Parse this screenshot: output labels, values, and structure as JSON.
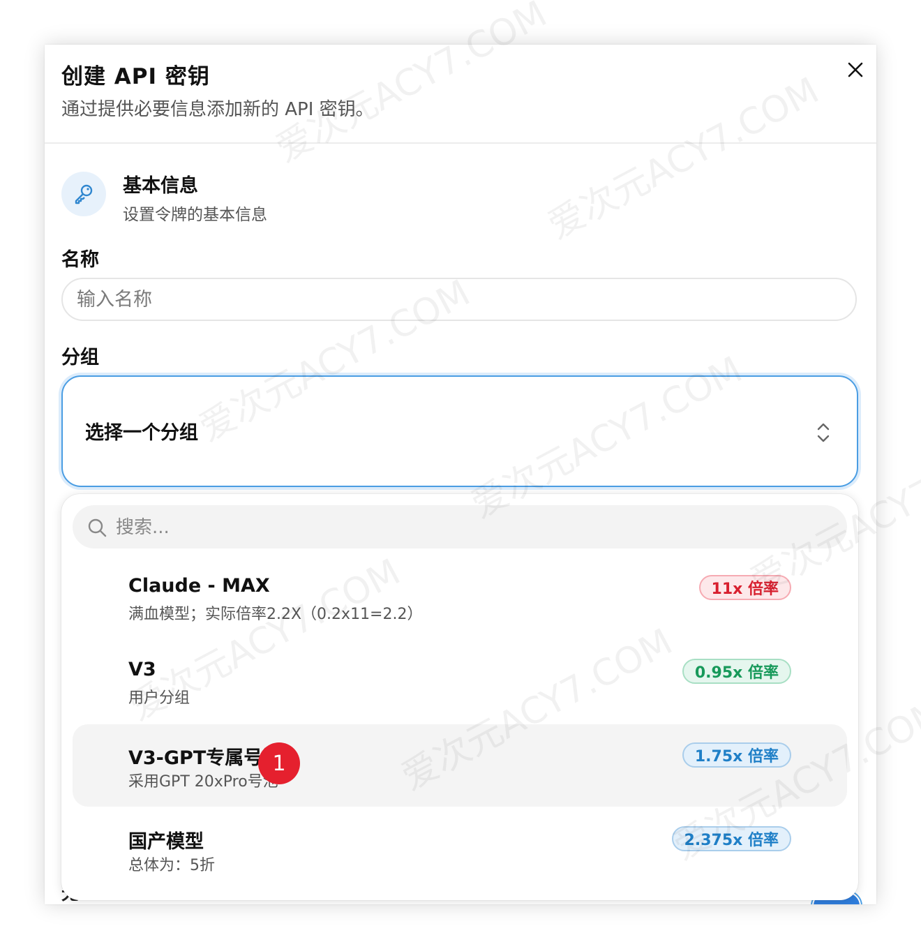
{
  "dialog": {
    "title": "创建 API 密钥",
    "subtitle": "通过提供必要信息添加新的 API 密钥。",
    "close_icon": "close-icon"
  },
  "section": {
    "icon": "key-icon",
    "title": "基本信息",
    "subtitle": "设置令牌的基本信息"
  },
  "name_field": {
    "label": "名称",
    "placeholder": "输入名称",
    "value": ""
  },
  "group_field": {
    "label": "分组",
    "selected": "选择一个分组",
    "chevron_icon": "chevron-up-down-icon"
  },
  "dropdown": {
    "search_placeholder": "搜索...",
    "search_icon": "search-icon",
    "options": [
      {
        "name": "Claude - MAX",
        "desc": "满血模型；实际倍率2.2X（0.2x11=2.2）",
        "rate": "11x 倍率",
        "color": "#d8202f"
      },
      {
        "name": "V3",
        "desc": "用户分组",
        "rate": "0.95x 倍率",
        "color": "#17995a"
      },
      {
        "name": "V3-GPT专属号池",
        "desc": "采用GPT 20xPro号池",
        "rate": "1.75x 倍率",
        "color": "#1f7fc7",
        "highlighted": true
      },
      {
        "name": "国产模型",
        "desc": "总体为：5折",
        "rate": "2.375x 倍率",
        "color": "#1f7fc7"
      }
    ]
  },
  "marker": {
    "label": "1",
    "color": "#e5202e"
  },
  "accent_color": "#4a9de3",
  "watermark": "爱次元ACY7.COM"
}
